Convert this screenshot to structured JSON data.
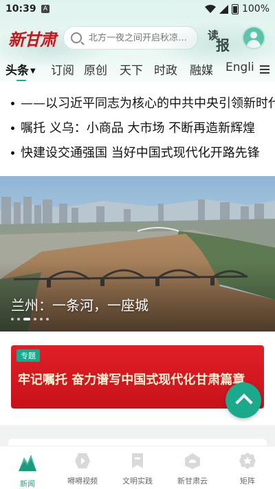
{
  "status_bar": {
    "time": "10:39",
    "notification_icon": "A",
    "battery": "100%"
  },
  "header": {
    "logo_text": "新甘肃",
    "search_placeholder": "北方一夜之间开启秋凉…",
    "read_paper_top": "读",
    "read_paper_bottom": "报"
  },
  "tabs": [
    {
      "label": "头条",
      "active": true
    },
    {
      "label": "订阅"
    },
    {
      "label": "原创"
    },
    {
      "label": "天下"
    },
    {
      "label": "时政"
    },
    {
      "label": "融媒"
    },
    {
      "label": "Engli"
    }
  ],
  "headlines": [
    "——以习近平同志为核心的中共中央引领新时代",
    "嘱托  义乌：小商品  大市场  不断再造新辉煌",
    "快建设交通强国  当好中国式现代化开路先锋"
  ],
  "hero": {
    "caption": "兰州：一条河，一座城",
    "slide_count": 6,
    "active_slide": 2
  },
  "banner": {
    "tag": "专题",
    "title": "牢记嘱托  奋力谱写中国式现代化甘肃篇章"
  },
  "bottom_nav": [
    {
      "label": "新闻",
      "icon": "mountain-news-icon",
      "active": true
    },
    {
      "label": "嘚嘚视频",
      "icon": "video-play-icon"
    },
    {
      "label": "文明实践",
      "icon": "flag-icon"
    },
    {
      "label": "新甘肃云",
      "icon": "cloud-icon"
    },
    {
      "label": "矩阵",
      "icon": "star-badge-icon"
    }
  ],
  "colors": {
    "accent": "#1aa98b",
    "brand_red": "#c8161d",
    "banner_red": "#d8141c"
  }
}
